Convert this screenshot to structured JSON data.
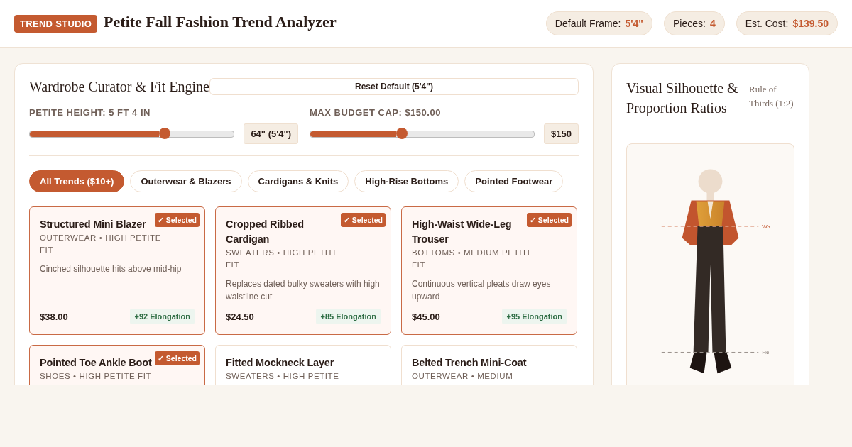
{
  "header": {
    "brand": "TREND STUDIO",
    "title": "Petite Fall Fashion Trend Analyzer",
    "stats": [
      {
        "label": "Default Frame:",
        "value": "5'4\""
      },
      {
        "label": "Pieces:",
        "value": "4"
      },
      {
        "label": "Est. Cost:",
        "value": "$139.50"
      }
    ]
  },
  "curator": {
    "title": "Wardrobe Curator & Fit Engine",
    "reset_button": "Reset Default (5'4\")",
    "sliders": [
      {
        "label": "PETITE HEIGHT: 5 FT 4 IN",
        "level": 0.66,
        "reading": "64\" (5'4\")"
      },
      {
        "label": "MAX BUDGET CAP: $150.00",
        "level": 0.41,
        "reading": "$150"
      }
    ],
    "filters": [
      {
        "label": "All Trends ($10+)",
        "selected": true
      },
      {
        "label": "Outerwear & Blazers",
        "selected": false
      },
      {
        "label": "Cardigans & Knits",
        "selected": false
      },
      {
        "label": "High-Rise Bottoms",
        "selected": false
      },
      {
        "label": "Pointed Footwear",
        "selected": false
      }
    ],
    "cards": [
      {
        "name": "Structured Mini Blazer",
        "tags": "OUTERWEAR • HIGH PETITE FIT",
        "description": "Cinched silhouette hits above mid-hip",
        "price": "$38.00",
        "score": "+92 Elongation",
        "selected": true,
        "badge": "✓ Selected"
      },
      {
        "name": "Cropped Ribbed Cardigan",
        "tags": "SWEATERS • HIGH PETITE FIT",
        "description": "Replaces dated bulky sweaters with high waistline cut",
        "price": "$24.50",
        "score": "+85 Elongation",
        "selected": true,
        "badge": "✓ Selected"
      },
      {
        "name": "High-Waist Wide-Leg Trouser",
        "tags": "BOTTOMS • MEDIUM PETITE FIT",
        "description": "Continuous vertical pleats draw eyes upward",
        "price": "$45.00",
        "score": "+95 Elongation",
        "selected": true,
        "badge": "✓ Selected"
      },
      {
        "name": "Pointed Toe Ankle Boot",
        "tags": "SHOES • HIGH PETITE FIT",
        "selected": true,
        "badge": "✓ Selected"
      },
      {
        "name": "Fitted Mockneck Layer",
        "tags": "SWEATERS • HIGH PETITE",
        "selected": false
      },
      {
        "name": "Belted Trench Mini-Coat",
        "tags": "OUTERWEAR • MEDIUM",
        "selected": false
      }
    ]
  },
  "silhouette": {
    "title": "Visual Silhouette & Proportion Ratios",
    "note": "Rule of Thirds (1:2)",
    "waist_label": "Wa",
    "hem_label": "He"
  }
}
